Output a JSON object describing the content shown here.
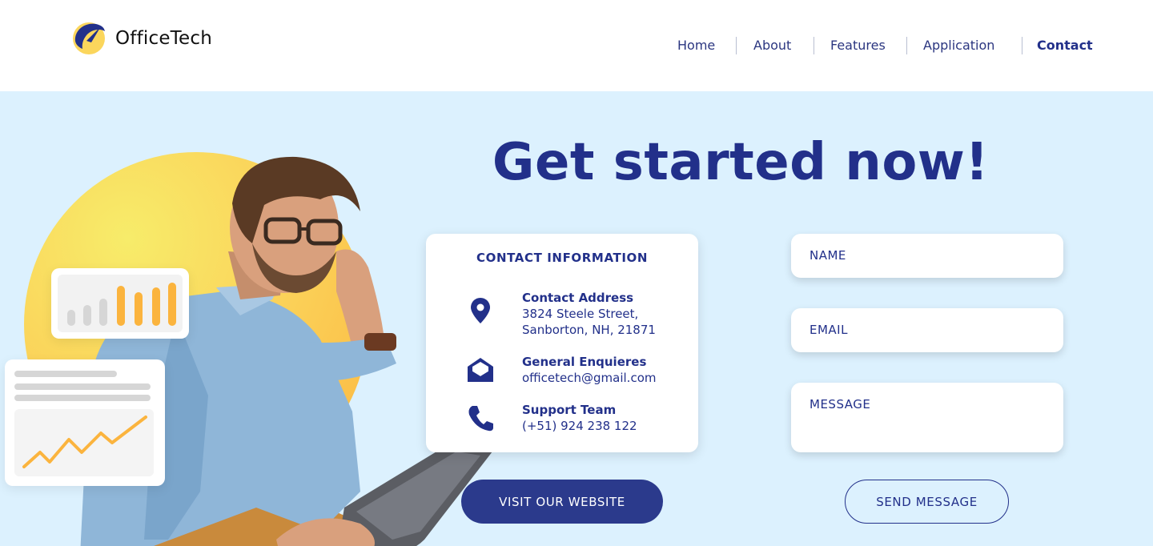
{
  "brand": {
    "name": "OfficeTech"
  },
  "nav": {
    "items": [
      {
        "label": "Home"
      },
      {
        "label": "About"
      },
      {
        "label": "Features"
      },
      {
        "label": "Application"
      },
      {
        "label": "Contact",
        "active": true
      }
    ]
  },
  "hero": {
    "title": "Get started now!"
  },
  "contact_info": {
    "heading": "CONTACT INFORMATION",
    "address": {
      "label": "Contact Address",
      "line1": "3824 Steele Street,",
      "line2": "Sanborton, NH, 21871",
      "icon": "map-pin-icon"
    },
    "enquiries": {
      "label": "General Enquieres",
      "value": "officetech@gmail.com",
      "icon": "mail-icon"
    },
    "support": {
      "label": "Support Team",
      "value": "(+51) 924 238 122",
      "icon": "phone-icon"
    }
  },
  "buttons": {
    "visit": "VISIT OUR WEBSITE",
    "send": "SEND MESSAGE"
  },
  "form": {
    "name_placeholder": "NAME",
    "email_placeholder": "EMAIL",
    "message_placeholder": "MESSAGE"
  },
  "colors": {
    "primary": "#22308a",
    "hero_bg": "#dcf1fe",
    "accent": "#fbb43e"
  }
}
